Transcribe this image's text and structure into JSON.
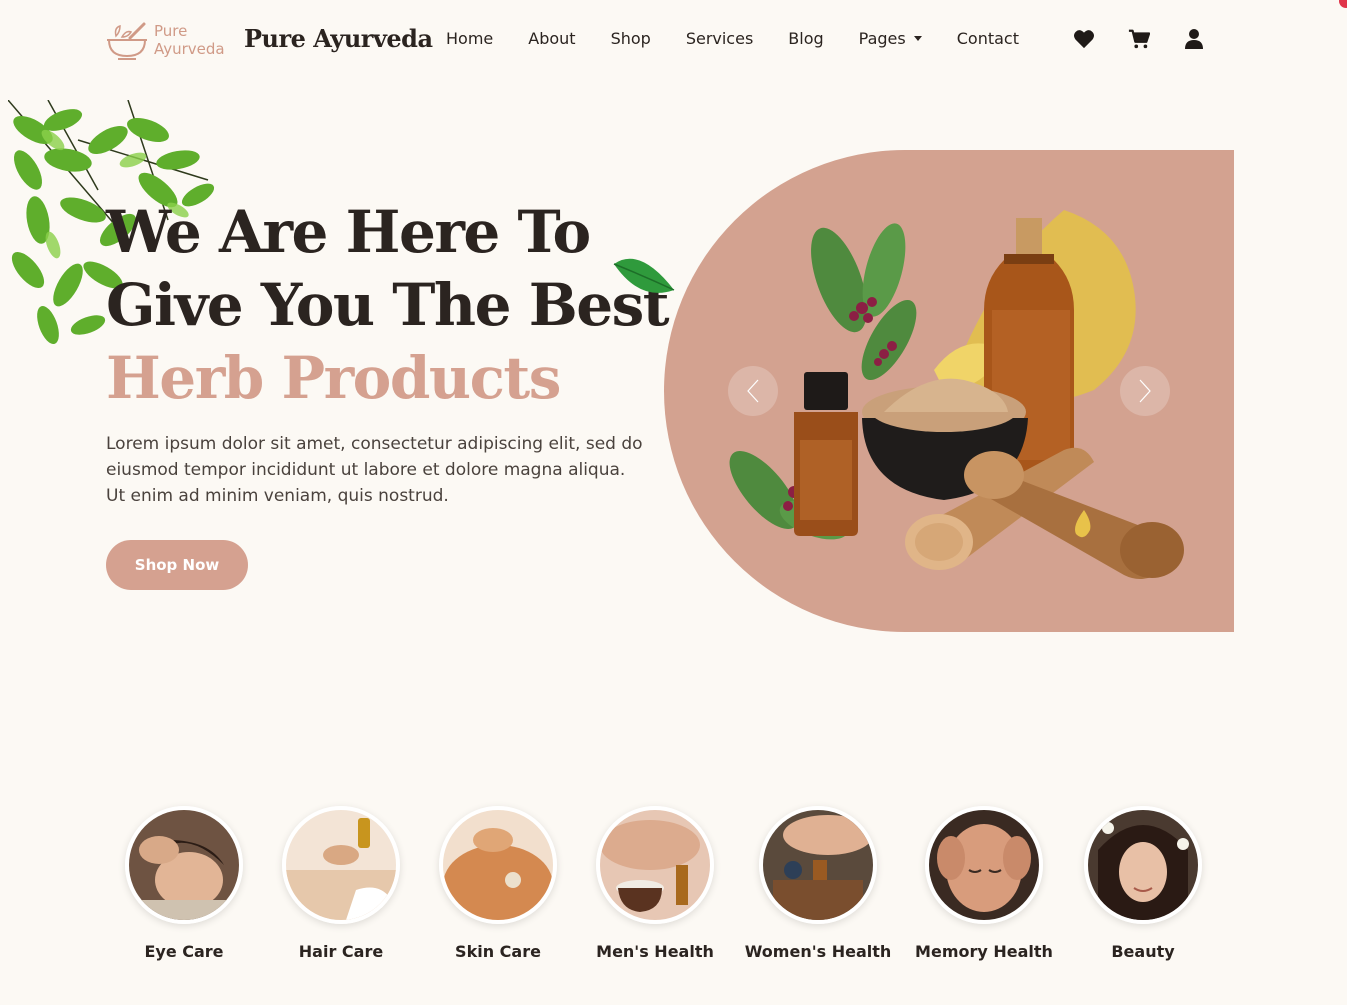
{
  "brand": {
    "logo_text_line1": "Pure",
    "logo_text_line2": "Ayurveda",
    "name": "Pure Ayurveda",
    "logo_icon": "mortar-pestle-icon"
  },
  "nav": {
    "items": [
      {
        "label": "Home"
      },
      {
        "label": "About"
      },
      {
        "label": "Shop"
      },
      {
        "label": "Services"
      },
      {
        "label": "Blog"
      },
      {
        "label": "Pages"
      },
      {
        "label": "Contact"
      }
    ],
    "icons": [
      "heart-icon",
      "cart-icon",
      "user-icon"
    ]
  },
  "hero": {
    "title_line1": "We Are Here To",
    "title_line2": "Give You The Best",
    "title_accent": "Herb Products",
    "description": "Lorem ipsum dolor sit amet, consectetur adipiscing elit, sed do eiusmod tempor incididunt ut labore et dolore magna aliqua. Ut enim ad minim veniam, quis nostrud.",
    "cta_label": "Shop Now"
  },
  "categories": [
    {
      "label": "Eye Care"
    },
    {
      "label": "Hair Care"
    },
    {
      "label": "Skin Care"
    },
    {
      "label": "Men's Health"
    },
    {
      "label": "Women's Health"
    },
    {
      "label": "Memory Health"
    },
    {
      "label": "Beauty"
    }
  ],
  "colors": {
    "accent": "#d5a190",
    "panel": "#d3a290",
    "background": "#fcf9f4",
    "text": "#2b2420",
    "notification": "#e0354a"
  }
}
